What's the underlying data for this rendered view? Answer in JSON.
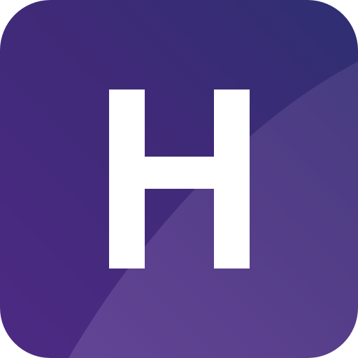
{
  "icon": {
    "name": "H app icon",
    "letter": "H",
    "colors": {
      "background_dark": "#2f2f72",
      "background_mid": "#3f2a78",
      "background_light": "#4d2a84",
      "sheen": "#8a6fb3",
      "glyph": "#ffffff"
    }
  }
}
